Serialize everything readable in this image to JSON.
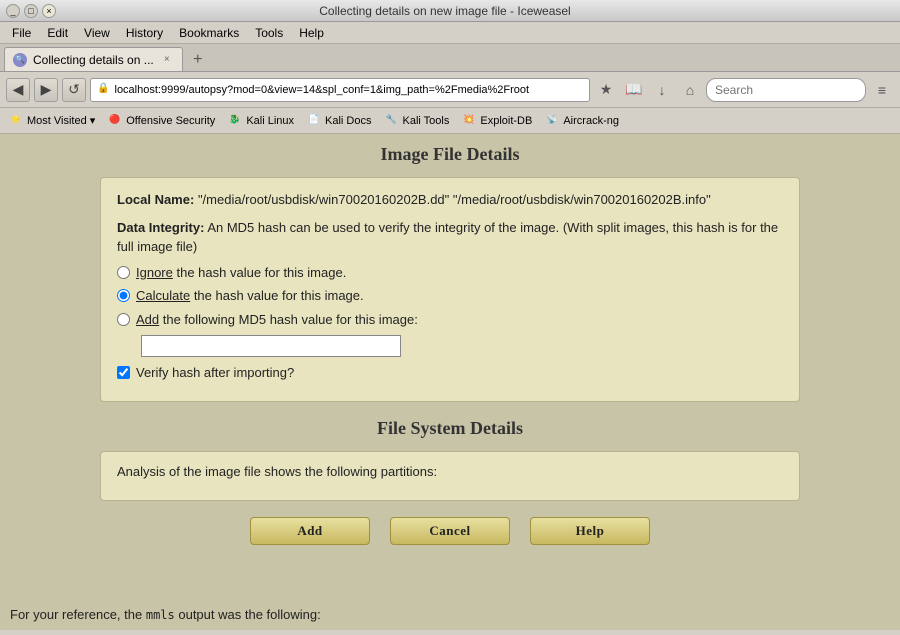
{
  "window": {
    "title": "Collecting details on new image file - Iceweasel",
    "controls": [
      "minimize",
      "maximize",
      "close"
    ]
  },
  "menubar": {
    "items": [
      "File",
      "Edit",
      "View",
      "History",
      "Bookmarks",
      "Tools",
      "Help"
    ]
  },
  "tab": {
    "label": "Collecting details on ...",
    "new_tab_icon": "+"
  },
  "navbar": {
    "back_label": "◀",
    "forward_label": "▶",
    "url": "localhost:9999/autopsy?mod=0&view=14&spl_conf=1&img_path=%2Fmedia%2Froot",
    "search_placeholder": "Search",
    "reload_label": "↺",
    "home_label": "⌂",
    "menu_label": "≡",
    "bookmark_label": "★",
    "reader_label": "📖",
    "download_label": "↓"
  },
  "bookmarks": {
    "items": [
      {
        "label": "Most Visited",
        "has_dropdown": true
      },
      {
        "label": "Offensive Security"
      },
      {
        "label": "Kali Linux"
      },
      {
        "label": "Kali Docs"
      },
      {
        "label": "Kali Tools"
      },
      {
        "label": "Exploit-DB"
      },
      {
        "label": "Aircrack-ng"
      }
    ]
  },
  "page": {
    "image_file_title": "Image File Details",
    "local_name_label": "Local Name:",
    "local_name_value": "\"/media/root/usbdisk/win70020160202B.dd\" \"/media/root/usbdisk/win70020160202B.info\"",
    "data_integrity_label": "Data Integrity:",
    "data_integrity_text": "An MD5 hash can be used to verify the integrity of the image. (With split images, this hash is for the full image file)",
    "radio_ignore_label": "Ignore the hash value for this image.",
    "radio_calculate_label": "Calculate the hash value for this image.",
    "radio_add_label": "Add the following MD5 hash value for this image:",
    "md5_placeholder": "",
    "verify_label": "Verify hash after importing?",
    "file_system_title": "File System Details",
    "analysis_text": "Analysis of the image file shows the following partitions:",
    "btn_add": "Add",
    "btn_cancel": "Cancel",
    "btn_help": "Help",
    "footer_text_before": "For your reference, the ",
    "footer_mono": "mmls",
    "footer_text_after": " output was the following:"
  }
}
